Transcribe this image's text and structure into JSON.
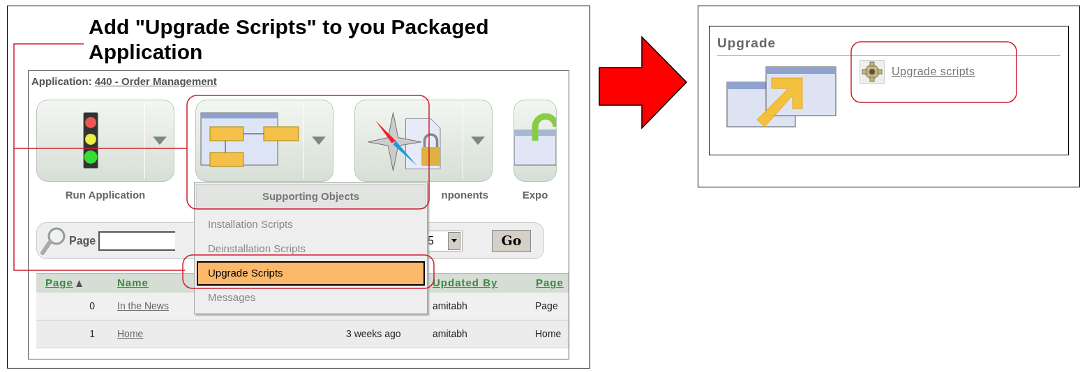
{
  "title": "Add \"Upgrade Scripts\" to you Packaged Application",
  "application": {
    "label": "Application:",
    "link": "440 - Order Management"
  },
  "tiles": [
    {
      "kind": "run",
      "label": "Run Application"
    },
    {
      "kind": "supporting"
    },
    {
      "kind": "shared",
      "label": "nponents"
    },
    {
      "kind": "export",
      "label": "Expo"
    }
  ],
  "search": {
    "label": "Page",
    "display": "5",
    "button": "Go"
  },
  "table": {
    "columns": [
      {
        "label": "Page",
        "sorted": true
      },
      {
        "label": "Name",
        "sorted": false
      },
      {
        "label": "Updated By",
        "sorted": false
      },
      {
        "label": "Page",
        "sorted": false
      }
    ],
    "rows": [
      {
        "page": "0",
        "name": "In the News",
        "updated_by": "amitabh",
        "column_5": "Page"
      },
      {
        "page": "1",
        "name": "Home",
        "column_3": "3 weeks ago",
        "updated_by": "amitabh",
        "column_5": "Home"
      }
    ]
  },
  "menu": {
    "header": "Supporting Objects",
    "items": [
      {
        "label": "Installation Scripts",
        "selected": false
      },
      {
        "label": "Deinstallation Scripts",
        "selected": false
      },
      {
        "label": "Upgrade Scripts",
        "selected": true
      },
      {
        "label": "Messages",
        "selected": false
      }
    ]
  },
  "upgrade_panel": {
    "title": "Upgrade",
    "link": "Upgrade scripts"
  }
}
